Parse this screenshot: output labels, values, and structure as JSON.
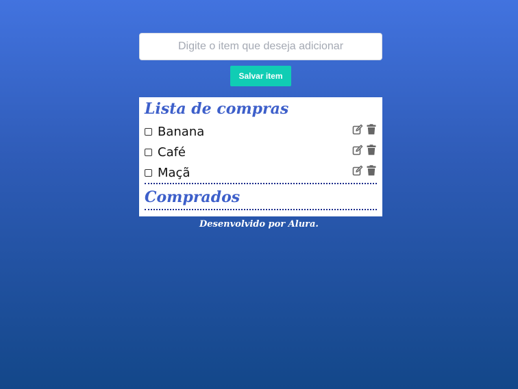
{
  "input": {
    "placeholder": "Digite o item que deseja adicionar",
    "value": ""
  },
  "save_button": {
    "label": "Salvar item"
  },
  "shopping_list": {
    "title": "Lista de compras",
    "items": [
      {
        "label": "Banana",
        "checked": false,
        "edit_icon": "edit-icon",
        "delete_icon": "trash-icon"
      },
      {
        "label": "Café",
        "checked": false,
        "edit_icon": "edit-icon",
        "delete_icon": "trash-icon"
      },
      {
        "label": "Maçã",
        "checked": false,
        "edit_icon": "edit-icon",
        "delete_icon": "trash-icon"
      }
    ]
  },
  "bought_list": {
    "title": "Comprados",
    "items": []
  },
  "footer": {
    "text": "Desenvolvido por Alura."
  },
  "colors": {
    "accent": "#10cdb4",
    "title": "#3d5fca",
    "divider": "#1a2a8a",
    "icon": "#666666",
    "background_top": "#4273df",
    "background_bottom": "#134789"
  }
}
